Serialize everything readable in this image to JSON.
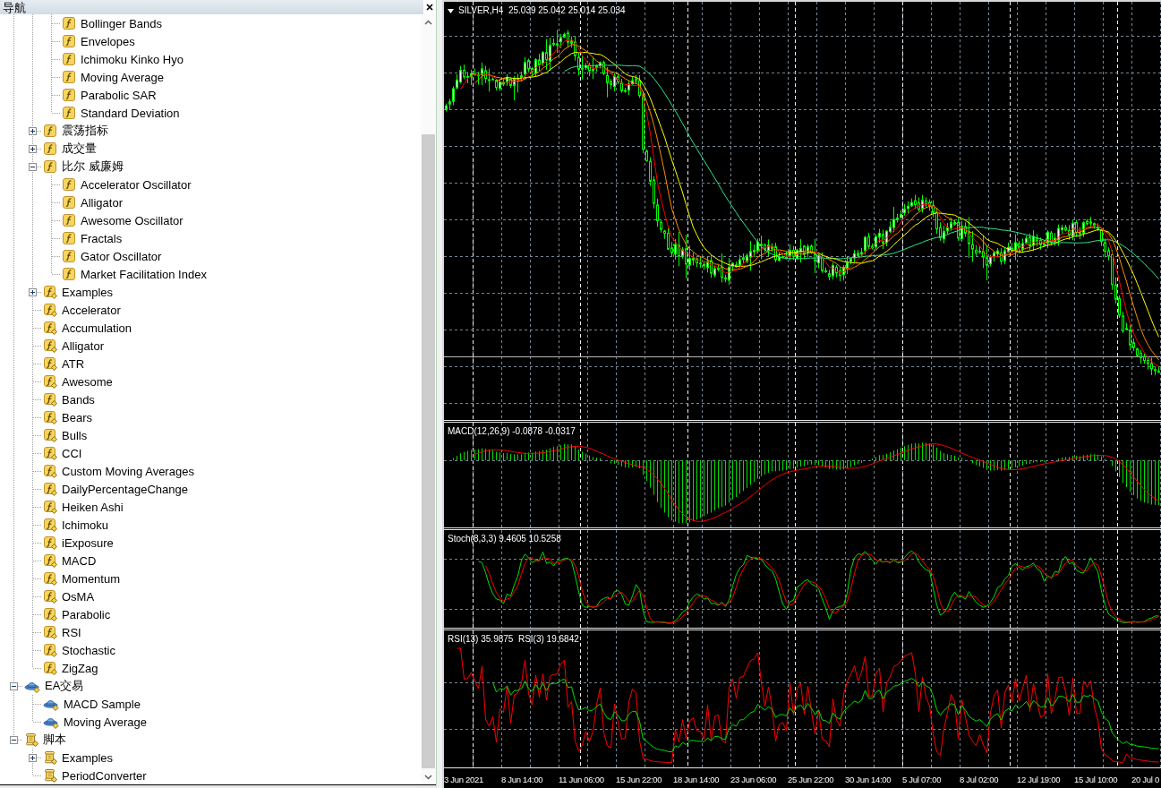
{
  "navigator": {
    "title": "导航",
    "tree": [
      {
        "children": [
          {
            "children": [
              {
                "label": "Bollinger Bands",
                "kind": "indicator"
              },
              {
                "label": "Envelopes",
                "kind": "indicator"
              },
              {
                "label": "Ichimoku Kinko Hyo",
                "kind": "indicator"
              },
              {
                "label": "Moving Average",
                "kind": "indicator"
              },
              {
                "label": "Parabolic SAR",
                "kind": "indicator"
              },
              {
                "label": "Standard Deviation",
                "kind": "indicator"
              }
            ]
          },
          {
            "label": "震荡指标",
            "kind": "indicator",
            "expanded": false
          },
          {
            "label": "成交量",
            "kind": "indicator",
            "expanded": false
          },
          {
            "label": "比尔 威廉姆",
            "kind": "indicator",
            "expanded": true,
            "children": [
              {
                "label": "Accelerator Oscillator",
                "kind": "indicator"
              },
              {
                "label": "Alligator",
                "kind": "indicator"
              },
              {
                "label": "Awesome Oscillator",
                "kind": "indicator"
              },
              {
                "label": "Fractals",
                "kind": "indicator"
              },
              {
                "label": "Gator Oscillator",
                "kind": "indicator"
              },
              {
                "label": "Market Facilitation Index",
                "kind": "indicator"
              }
            ]
          },
          {
            "label": "Examples",
            "kind": "custom",
            "expanded": false
          },
          {
            "label": "Accelerator",
            "kind": "custom"
          },
          {
            "label": "Accumulation",
            "kind": "custom"
          },
          {
            "label": "Alligator",
            "kind": "custom"
          },
          {
            "label": "ATR",
            "kind": "custom"
          },
          {
            "label": "Awesome",
            "kind": "custom"
          },
          {
            "label": "Bands",
            "kind": "custom"
          },
          {
            "label": "Bears",
            "kind": "custom"
          },
          {
            "label": "Bulls",
            "kind": "custom"
          },
          {
            "label": "CCI",
            "kind": "custom"
          },
          {
            "label": "Custom Moving Averages",
            "kind": "custom"
          },
          {
            "label": "DailyPercentageChange",
            "kind": "custom"
          },
          {
            "label": "Heiken Ashi",
            "kind": "custom"
          },
          {
            "label": "Ichimoku",
            "kind": "custom"
          },
          {
            "label": "iExposure",
            "kind": "custom"
          },
          {
            "label": "MACD",
            "kind": "custom"
          },
          {
            "label": "Momentum",
            "kind": "custom"
          },
          {
            "label": "OsMA",
            "kind": "custom"
          },
          {
            "label": "Parabolic",
            "kind": "custom"
          },
          {
            "label": "RSI",
            "kind": "custom"
          },
          {
            "label": "Stochastic",
            "kind": "custom"
          },
          {
            "label": "ZigZag",
            "kind": "custom"
          }
        ]
      },
      {
        "label": "EA交易",
        "kind": "expert",
        "expanded": true,
        "children": [
          {
            "label": "MACD Sample",
            "kind": "expert"
          },
          {
            "label": "Moving Average",
            "kind": "expert"
          }
        ]
      },
      {
        "label": "脚本",
        "kind": "script",
        "expanded": true,
        "children": [
          {
            "label": "Examples",
            "kind": "script",
            "expanded": false
          },
          {
            "label": "PeriodConverter",
            "kind": "script"
          }
        ]
      }
    ]
  },
  "chart": {
    "title": "SILVER,H4  25.039 25.042 25.014 25.034",
    "subwindows": [
      {
        "kind": "macd",
        "label": "MACD(12,26,9) -0.0878 -0.0317"
      },
      {
        "kind": "stochastic",
        "label": "Stoch(8,3,3) 9.4605 10.5258"
      },
      {
        "kind": "rsi",
        "label": "RSI(13) 35.9875  RSI(3) 19.6842"
      }
    ],
    "time_axis": [
      "3 Jun 2021",
      "8 Jun 14:00",
      "11 Jun 06:00",
      "15 Jun 22:00",
      "18 Jun 14:00",
      "23 Jun 06:00",
      "25 Jun 22:00",
      "30 Jun 14:00",
      "5 Jul 07:00",
      "8 Jul 02:00",
      "12 Jul 19:00",
      "15 Jul 10:00",
      "20 Jul 0"
    ]
  }
}
